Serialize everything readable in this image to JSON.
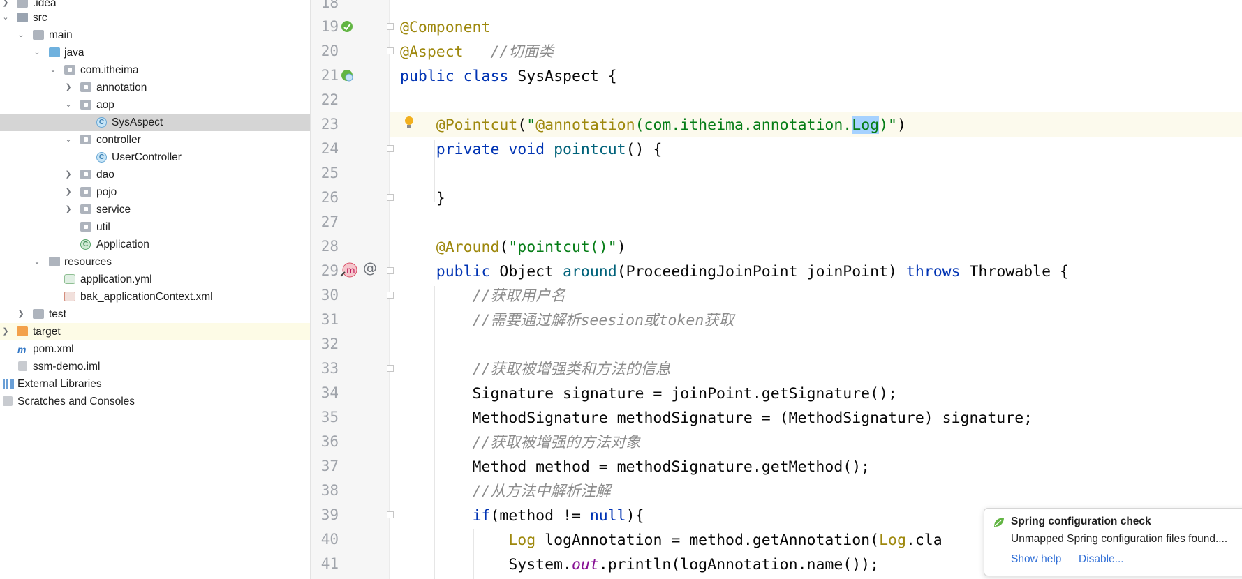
{
  "project_tree": {
    "items": [
      {
        "label": ".idea",
        "depth": 0,
        "expanded": false,
        "icon": "folder-icon"
      },
      {
        "label": "src",
        "depth": 0,
        "expanded": true,
        "icon": "folder-icon"
      },
      {
        "label": "main",
        "depth": 1,
        "expanded": true,
        "icon": "folder-icon"
      },
      {
        "label": "java",
        "depth": 2,
        "expanded": true,
        "icon": "source-folder-icon"
      },
      {
        "label": "com.itheima",
        "depth": 3,
        "expanded": true,
        "icon": "package-icon"
      },
      {
        "label": "annotation",
        "depth": 4,
        "expanded": false,
        "icon": "package-icon"
      },
      {
        "label": "aop",
        "depth": 4,
        "expanded": true,
        "icon": "package-icon"
      },
      {
        "label": "SysAspect",
        "depth": 5,
        "icon": "class-icon",
        "selected": true
      },
      {
        "label": "controller",
        "depth": 4,
        "expanded": true,
        "icon": "package-icon"
      },
      {
        "label": "UserController",
        "depth": 5,
        "icon": "class-icon"
      },
      {
        "label": "dao",
        "depth": 4,
        "expanded": false,
        "icon": "package-icon"
      },
      {
        "label": "pojo",
        "depth": 4,
        "expanded": false,
        "icon": "package-icon"
      },
      {
        "label": "service",
        "depth": 4,
        "expanded": false,
        "icon": "package-icon"
      },
      {
        "label": "util",
        "depth": 4,
        "icon": "package-icon"
      },
      {
        "label": "Application",
        "depth": 4,
        "icon": "spring-boot-class-icon"
      },
      {
        "label": "resources",
        "depth": 2,
        "expanded": true,
        "icon": "resources-folder-icon"
      },
      {
        "label": "application.yml",
        "depth": 3,
        "icon": "yaml-file-icon"
      },
      {
        "label": "bak_applicationContext.xml",
        "depth": 3,
        "icon": "xml-file-icon"
      },
      {
        "label": "test",
        "depth": 1,
        "expanded": false,
        "icon": "folder-icon"
      },
      {
        "label": "target",
        "depth": 0,
        "expanded": false,
        "icon": "excluded-folder-icon",
        "excluded": true
      },
      {
        "label": "pom.xml",
        "depth": 0,
        "icon": "maven-icon"
      },
      {
        "label": "ssm-demo.iml",
        "depth": 0,
        "icon": "iml-file-icon"
      },
      {
        "label": "External Libraries",
        "depth": -1,
        "icon": "libraries-icon"
      },
      {
        "label": "Scratches and Consoles",
        "depth": -1,
        "icon": "scratches-icon"
      }
    ]
  },
  "editor": {
    "lines": [
      {
        "n": "18",
        "code": ""
      },
      {
        "n": "19",
        "code": "@Component"
      },
      {
        "n": "20",
        "code": "@Aspect   //切面类"
      },
      {
        "n": "21",
        "code": "public class SysAspect {"
      },
      {
        "n": "22",
        "code": ""
      },
      {
        "n": "23",
        "code": "    @Pointcut(\"@annotation(com.itheima.annotation.Log)\")"
      },
      {
        "n": "24",
        "code": "    private void pointcut() {"
      },
      {
        "n": "25",
        "code": ""
      },
      {
        "n": "26",
        "code": "    }"
      },
      {
        "n": "27",
        "code": ""
      },
      {
        "n": "28",
        "code": "    @Around(\"pointcut()\")"
      },
      {
        "n": "29",
        "code": "    public Object around(ProceedingJoinPoint joinPoint) throws Throwable {"
      },
      {
        "n": "30",
        "code": "        //获取用户名"
      },
      {
        "n": "31",
        "code": "        //需要通过解析seesion或token获取"
      },
      {
        "n": "32",
        "code": ""
      },
      {
        "n": "33",
        "code": "        //获取被增强类和方法的信息"
      },
      {
        "n": "34",
        "code": "        Signature signature = joinPoint.getSignature();"
      },
      {
        "n": "35",
        "code": "        MethodSignature methodSignature = (MethodSignature) signature;"
      },
      {
        "n": "36",
        "code": "        //获取被增强的方法对象"
      },
      {
        "n": "37",
        "code": "        Method method = methodSignature.getMethod();"
      },
      {
        "n": "38",
        "code": "        //从方法中解析注解"
      },
      {
        "n": "39",
        "code": "        if(method != null){"
      },
      {
        "n": "40",
        "code": "            Log logAnnotation = method.getAnnotation(Log.cla"
      },
      {
        "n": "41",
        "code": "            System.out.println(logAnnotation.name());"
      }
    ]
  },
  "notification": {
    "title": "Spring configuration check",
    "body": "Unmapped Spring configuration files found....",
    "show_help": "Show help",
    "disable": "Disable..."
  },
  "colors": {
    "keyword": "#0033b3",
    "annotation": "#9e880d",
    "string": "#067d17",
    "comment": "#8c8c8c",
    "method_decl": "#00627a",
    "static_field": "#871094",
    "selection": "#a6d2ff",
    "selected_tree_row": "#d5d5d5",
    "link": "#2f6ed6"
  }
}
